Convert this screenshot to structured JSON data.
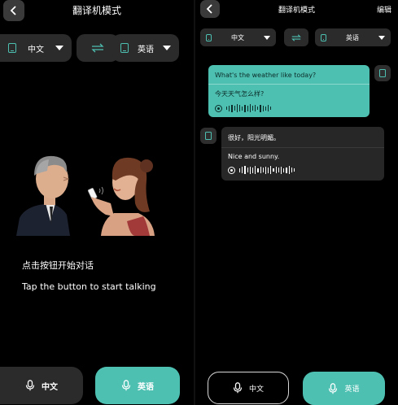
{
  "left": {
    "title": "翻译机模式",
    "source_lang": "中文",
    "target_lang": "英语",
    "hint_cn": "点击按钮开始对话",
    "hint_en": "Tap the button to start talking",
    "btn_cn": "中文",
    "btn_en": "英语"
  },
  "right": {
    "title": "翻译机模式",
    "edit_label": "编辑",
    "source_lang": "中文",
    "target_lang": "英语",
    "messages": [
      {
        "original": "What's the weather like today?",
        "translation": "今天天气怎么样?"
      },
      {
        "original": "很好，阳光明媚。",
        "translation": "Nice and sunny."
      }
    ],
    "btn_cn": "中文",
    "btn_en": "英语"
  },
  "colors": {
    "accent": "#4ec0b2",
    "pill": "#2b2b2b",
    "background": "#000000"
  }
}
